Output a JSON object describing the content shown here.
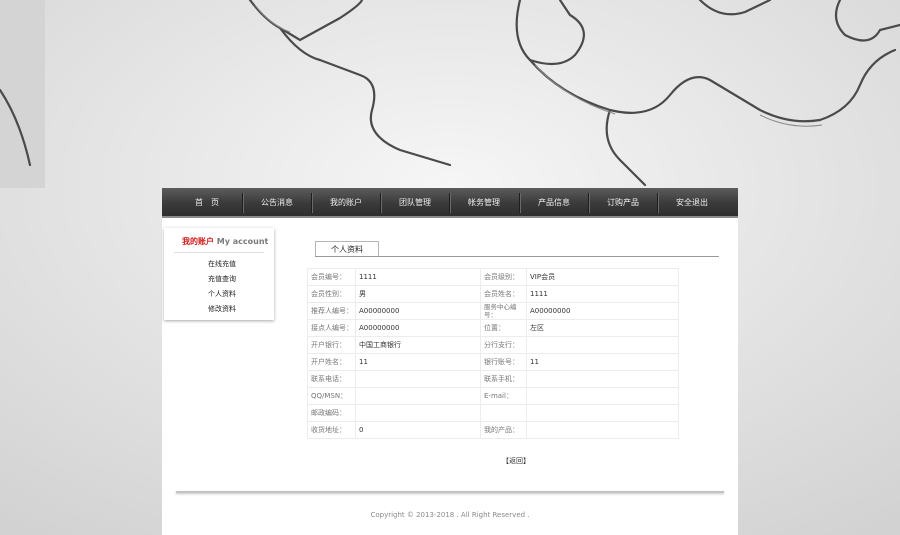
{
  "nav": {
    "items": [
      "首　页",
      "公告消息",
      "我的账户",
      "团队管理",
      "帐务管理",
      "产品信息",
      "订购产品",
      "安全退出"
    ]
  },
  "side": {
    "title_cn": "我的账户",
    "title_en": "My account",
    "links": [
      "在线充值",
      "充值查询",
      "个人资料",
      "修改资料"
    ]
  },
  "tab": {
    "label": "个人资料"
  },
  "profile": {
    "rows": [
      [
        "会员编号：",
        "1111",
        "会员级别：",
        "VIP会员"
      ],
      [
        "会员性别：",
        "男",
        "会员姓名：",
        "1111"
      ],
      [
        "推荐人编号：",
        "A00000000",
        "服务中心编号：",
        "A00000000"
      ],
      [
        "接点人编号：",
        "A00000000",
        "位置：",
        "左区"
      ],
      [
        "开户银行：",
        "中国工商银行",
        "分行支行：",
        ""
      ],
      [
        "开户姓名：",
        "11",
        "银行账号：",
        "11"
      ],
      [
        "联系电话：",
        "",
        "联系手机：",
        ""
      ],
      [
        "QQ/MSN：",
        "",
        "E-mail：",
        ""
      ],
      [
        "邮政编码：",
        "",
        "",
        ""
      ],
      [
        "收货地址：",
        "0",
        "我的产品：",
        ""
      ]
    ]
  },
  "back_label": "【返回】",
  "footer": {
    "copyright": "Copyright © 2013-2018 . All Right Reserved ."
  }
}
